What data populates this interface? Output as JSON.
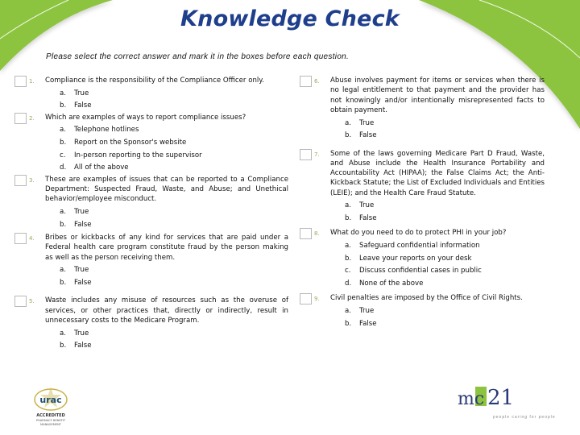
{
  "page": {
    "title": "Knowledge Check",
    "instructions": "Please select the correct answer and mark it in the boxes before each question."
  },
  "colors": {
    "title": "#1f3f8c",
    "accent_green": "#8cc43f",
    "question_number": "#9aab5a"
  },
  "questions": [
    {
      "number": "1.",
      "text": "Compliance is the responsibility of the Compliance Officer only.",
      "options": [
        {
          "letter": "a.",
          "label": "True"
        },
        {
          "letter": "b.",
          "label": "False"
        }
      ]
    },
    {
      "number": "2.",
      "text": "Which are examples of ways to report compliance issues?",
      "options": [
        {
          "letter": "a.",
          "label": "Telephone hotlines"
        },
        {
          "letter": "b.",
          "label": "Report on the Sponsor's website"
        },
        {
          "letter": "c.",
          "label": "In-person reporting to the supervisor"
        },
        {
          "letter": "d.",
          "label": "All of the above"
        }
      ]
    },
    {
      "number": "3.",
      "text": "These are examples of issues that can be reported to a Compliance Department: Suspected Fraud, Waste, and Abuse; and Unethical behavior/employee misconduct.",
      "options": [
        {
          "letter": "a.",
          "label": "True"
        },
        {
          "letter": "b.",
          "label": "False"
        }
      ]
    },
    {
      "number": "4.",
      "text": "Bribes or kickbacks of any kind for services that are paid under a Federal health care program constitute fraud by the person making as well as the person receiving them.",
      "options": [
        {
          "letter": "a.",
          "label": "True"
        },
        {
          "letter": "b.",
          "label": "False"
        }
      ]
    },
    {
      "number": "5.",
      "text": "Waste includes any misuse of resources such as the overuse of services, or other practices that, directly or indirectly, result in unnecessary costs to the Medicare Program.",
      "options": [
        {
          "letter": "a.",
          "label": "True"
        },
        {
          "letter": "b.",
          "label": "False"
        }
      ]
    },
    {
      "number": "6.",
      "text": "Abuse involves payment for items or services when there is no legal entitlement to that payment and the provider has not knowingly and/or intentionally misrepresented facts to obtain payment.",
      "options": [
        {
          "letter": "a.",
          "label": "True"
        },
        {
          "letter": "b.",
          "label": "False"
        }
      ]
    },
    {
      "number": "7.",
      "text": "Some of the laws governing Medicare Part D Fraud, Waste, and Abuse include the Health Insurance Portability and Accountability Act (HIPAA); the False Claims Act; the Anti-Kickback Statute; the List of Excluded Individuals and Entities (LEIE); and the Health Care Fraud Statute.",
      "options": [
        {
          "letter": "a.",
          "label": "True"
        },
        {
          "letter": "b.",
          "label": "False"
        }
      ]
    },
    {
      "number": "8.",
      "text": "What do you need to do to protect PHI in your job?",
      "options": [
        {
          "letter": "a.",
          "label": "Safeguard confidential information"
        },
        {
          "letter": "b.",
          "label": "Leave your reports on your desk"
        },
        {
          "letter": "c.",
          "label": "Discuss confidential cases in public"
        },
        {
          "letter": "d.",
          "label": "None of the above"
        }
      ]
    },
    {
      "number": "9.",
      "text": "Civil penalties are imposed by the Office of Civil Rights.",
      "options": [
        {
          "letter": "a.",
          "label": "True"
        },
        {
          "letter": "b.",
          "label": "False"
        }
      ]
    }
  ],
  "footer": {
    "urac_logo": {
      "name": "urac",
      "line1": "ACCREDITED",
      "line2": "PHARMACY BENEFIT",
      "line3": "MANAGEMENT"
    },
    "mc21_logo": {
      "text_mc": "mc",
      "text_21": "21",
      "tagline": "people caring for people"
    }
  }
}
